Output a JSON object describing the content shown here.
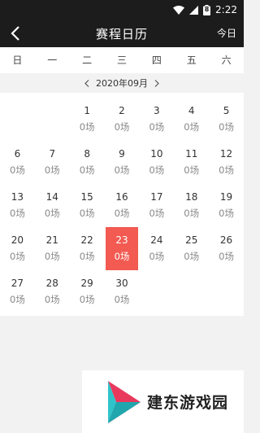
{
  "status": {
    "time": "2:22",
    "battery": "8"
  },
  "header": {
    "title": "赛程日历",
    "today_label": "今日"
  },
  "weekdays": [
    "日",
    "一",
    "二",
    "三",
    "四",
    "五",
    "六"
  ],
  "month": {
    "label": "2020年09月",
    "prev_icon": "chevron-left-icon",
    "next_icon": "chevron-right-icon"
  },
  "calendar": {
    "leading_blanks": 2,
    "selected_day": "23",
    "days": [
      {
        "day": "1",
        "count": "0场"
      },
      {
        "day": "2",
        "count": "0场"
      },
      {
        "day": "3",
        "count": "0场"
      },
      {
        "day": "4",
        "count": "0场"
      },
      {
        "day": "5",
        "count": "0场"
      },
      {
        "day": "6",
        "count": "0场"
      },
      {
        "day": "7",
        "count": "0场"
      },
      {
        "day": "8",
        "count": "0场"
      },
      {
        "day": "9",
        "count": "0场"
      },
      {
        "day": "10",
        "count": "0场"
      },
      {
        "day": "11",
        "count": "0场"
      },
      {
        "day": "12",
        "count": "0场"
      },
      {
        "day": "13",
        "count": "0场"
      },
      {
        "day": "14",
        "count": "0场"
      },
      {
        "day": "15",
        "count": "0场"
      },
      {
        "day": "16",
        "count": "0场"
      },
      {
        "day": "17",
        "count": "0场"
      },
      {
        "day": "18",
        "count": "0场"
      },
      {
        "day": "19",
        "count": "0场"
      },
      {
        "day": "20",
        "count": "0场"
      },
      {
        "day": "21",
        "count": "0场"
      },
      {
        "day": "22",
        "count": "0场"
      },
      {
        "day": "23",
        "count": "0场"
      },
      {
        "day": "24",
        "count": "0场"
      },
      {
        "day": "25",
        "count": "0场"
      },
      {
        "day": "26",
        "count": "0场"
      },
      {
        "day": "27",
        "count": "0场"
      },
      {
        "day": "28",
        "count": "0场"
      },
      {
        "day": "29",
        "count": "0场"
      },
      {
        "day": "30",
        "count": "0场"
      }
    ]
  },
  "watermark": {
    "text": "建东游戏园"
  },
  "colors": {
    "header_bg": "#1c1c1c",
    "selected": "#f25a52",
    "page_bg": "#f2f2f2"
  }
}
